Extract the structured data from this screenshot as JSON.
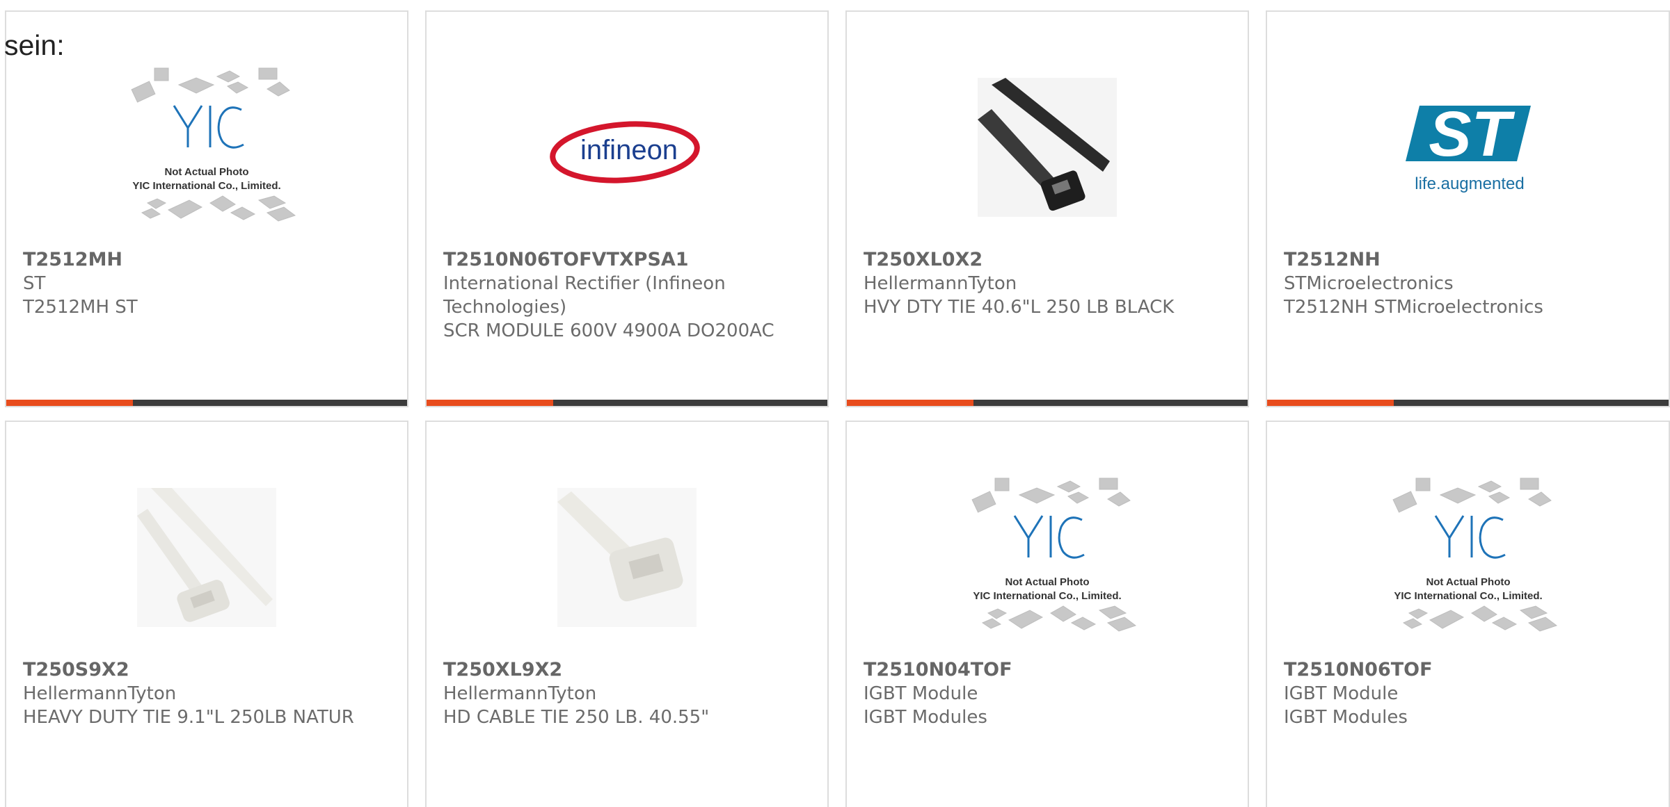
{
  "intro_text": "sein:",
  "placeholder": {
    "line1": "Not Actual Photo",
    "line2": "YIC International Co., Limited.",
    "logo_text": "YIC"
  },
  "brand_logos": {
    "infineon": "infineon",
    "st_tagline": "life.augmented",
    "st_mark": "ST"
  },
  "colors": {
    "accent": "#e84c1d",
    "bar": "#3c3c3c",
    "text": "#6b6b6b"
  },
  "products": [
    {
      "part": "T2512MH",
      "maker": "ST",
      "desc": "T2512MH ST",
      "image": "placeholder"
    },
    {
      "part": "T2510N06TOFVTXPSA1",
      "maker": "International Rectifier (Infineon Technologies)",
      "desc": "SCR MODULE 600V 4900A DO200AC",
      "image": "infineon-logo"
    },
    {
      "part": "T250XL0X2",
      "maker": "HellermannTyton",
      "desc": "HVY DTY TIE 40.6\"L 250 LB BLACK",
      "image": "black-cable-tie"
    },
    {
      "part": "T2512NH",
      "maker": "STMicroelectronics",
      "desc": "T2512NH STMicroelectronics",
      "image": "st-logo"
    },
    {
      "part": "T250S9X2",
      "maker": "HellermannTyton",
      "desc": "HEAVY DUTY TIE 9.1\"L 250LB NATUR",
      "image": "white-cable-tie"
    },
    {
      "part": "T250XL9X2",
      "maker": "HellermannTyton",
      "desc": "HD CABLE TIE 250 LB. 40.55\"",
      "image": "white-cable-tie-head"
    },
    {
      "part": "T2510N04TOF",
      "maker": "IGBT Module",
      "desc": "IGBT Modules",
      "image": "placeholder"
    },
    {
      "part": "T2510N06TOF",
      "maker": "IGBT Module",
      "desc": "IGBT Modules",
      "image": "placeholder"
    }
  ]
}
